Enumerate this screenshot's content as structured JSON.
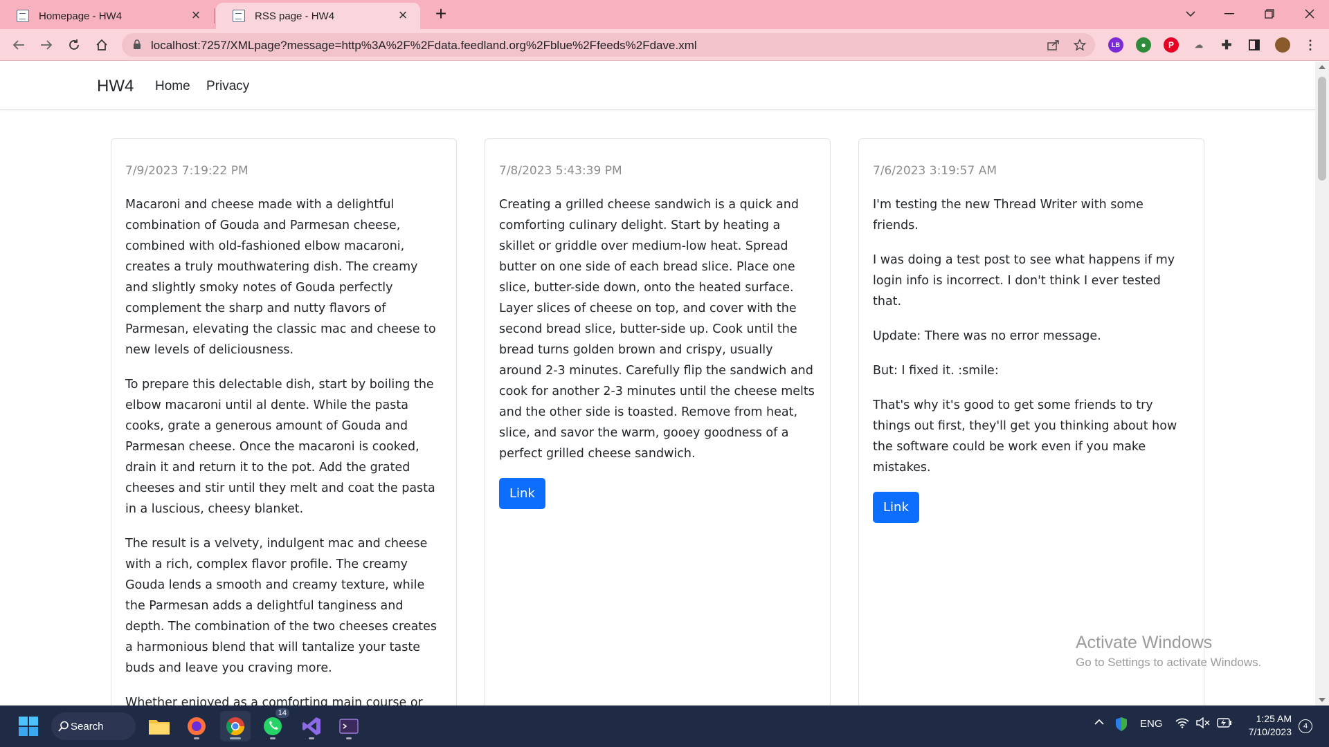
{
  "browser": {
    "tabs": [
      {
        "title": "Homepage - HW4",
        "active": false
      },
      {
        "title": "RSS page - HW4",
        "active": true
      }
    ],
    "url_host": "localhost",
    "url_rest": ":7257/XMLpage?message=http%3A%2F%2Fdata.feedland.org%2Fblue%2Ffeeds%2Fdave.xml",
    "extension_badge_label": "LB",
    "theme_color": "#f7b1bf"
  },
  "navbar": {
    "brand": "HW4",
    "links": [
      "Home",
      "Privacy"
    ]
  },
  "cards": [
    {
      "date": "7/9/2023 7:19:22 PM",
      "paragraphs": [
        "Macaroni and cheese made with a delightful combination of Gouda and Parmesan cheese, combined with old-fashioned elbow macaroni, creates a truly mouthwatering dish. The creamy and slightly smoky notes of Gouda perfectly complement the sharp and nutty flavors of Parmesan, elevating the classic mac and cheese to new levels of deliciousness.",
        "To prepare this delectable dish, start by boiling the elbow macaroni until al dente. While the pasta cooks, grate a generous amount of Gouda and Parmesan cheese. Once the macaroni is cooked, drain it and return it to the pot. Add the grated cheeses and stir until they melt and coat the pasta in a luscious, cheesy blanket.",
        "The result is a velvety, indulgent mac and cheese with a rich, complex flavor profile. The creamy Gouda lends a smooth and creamy texture, while the Parmesan adds a delightful tanginess and depth. The combination of the two cheeses creates a harmonious blend that will tantalize your taste buds and leave you craving more.",
        "Whether enjoyed as a comforting main course or"
      ]
    },
    {
      "date": "7/8/2023 5:43:39 PM",
      "paragraphs": [
        "Creating a grilled cheese sandwich is a quick and comforting culinary delight. Start by heating a skillet or griddle over medium-low heat. Spread butter on one side of each bread slice. Place one slice, butter-side down, onto the heated surface. Layer slices of cheese on top, and cover with the second bread slice, butter-side up. Cook until the bread turns golden brown and crispy, usually around 2-3 minutes. Carefully flip the sandwich and cook for another 2-3 minutes until the cheese melts and the other side is toasted. Remove from heat, slice, and savor the warm, gooey goodness of a perfect grilled cheese sandwich."
      ],
      "link_label": "Link"
    },
    {
      "date": "7/6/2023 3:19:57 AM",
      "paragraphs": [
        "I'm testing the new Thread Writer with some friends.",
        "I was doing a test post to see what happens if my login info is incorrect. I don't think I ever tested that.",
        "Update: There was no error message.",
        "But: I fixed it. :smile:",
        "That's why it's good to get some friends to try things out first, they'll get you thinking about how the software could be work even if you make mistakes."
      ],
      "link_label": "Link"
    }
  ],
  "watermark": {
    "line1": "Activate Windows",
    "line2": "Go to Settings to activate Windows."
  },
  "taskbar": {
    "search_label": "Search",
    "whatsapp_badge": "14",
    "language": "ENG",
    "time": "1:25 AM",
    "date": "7/10/2023",
    "notification_count": "4"
  },
  "colors": {
    "link_button": "#0d6efd",
    "taskbar": "#1f2a44"
  }
}
